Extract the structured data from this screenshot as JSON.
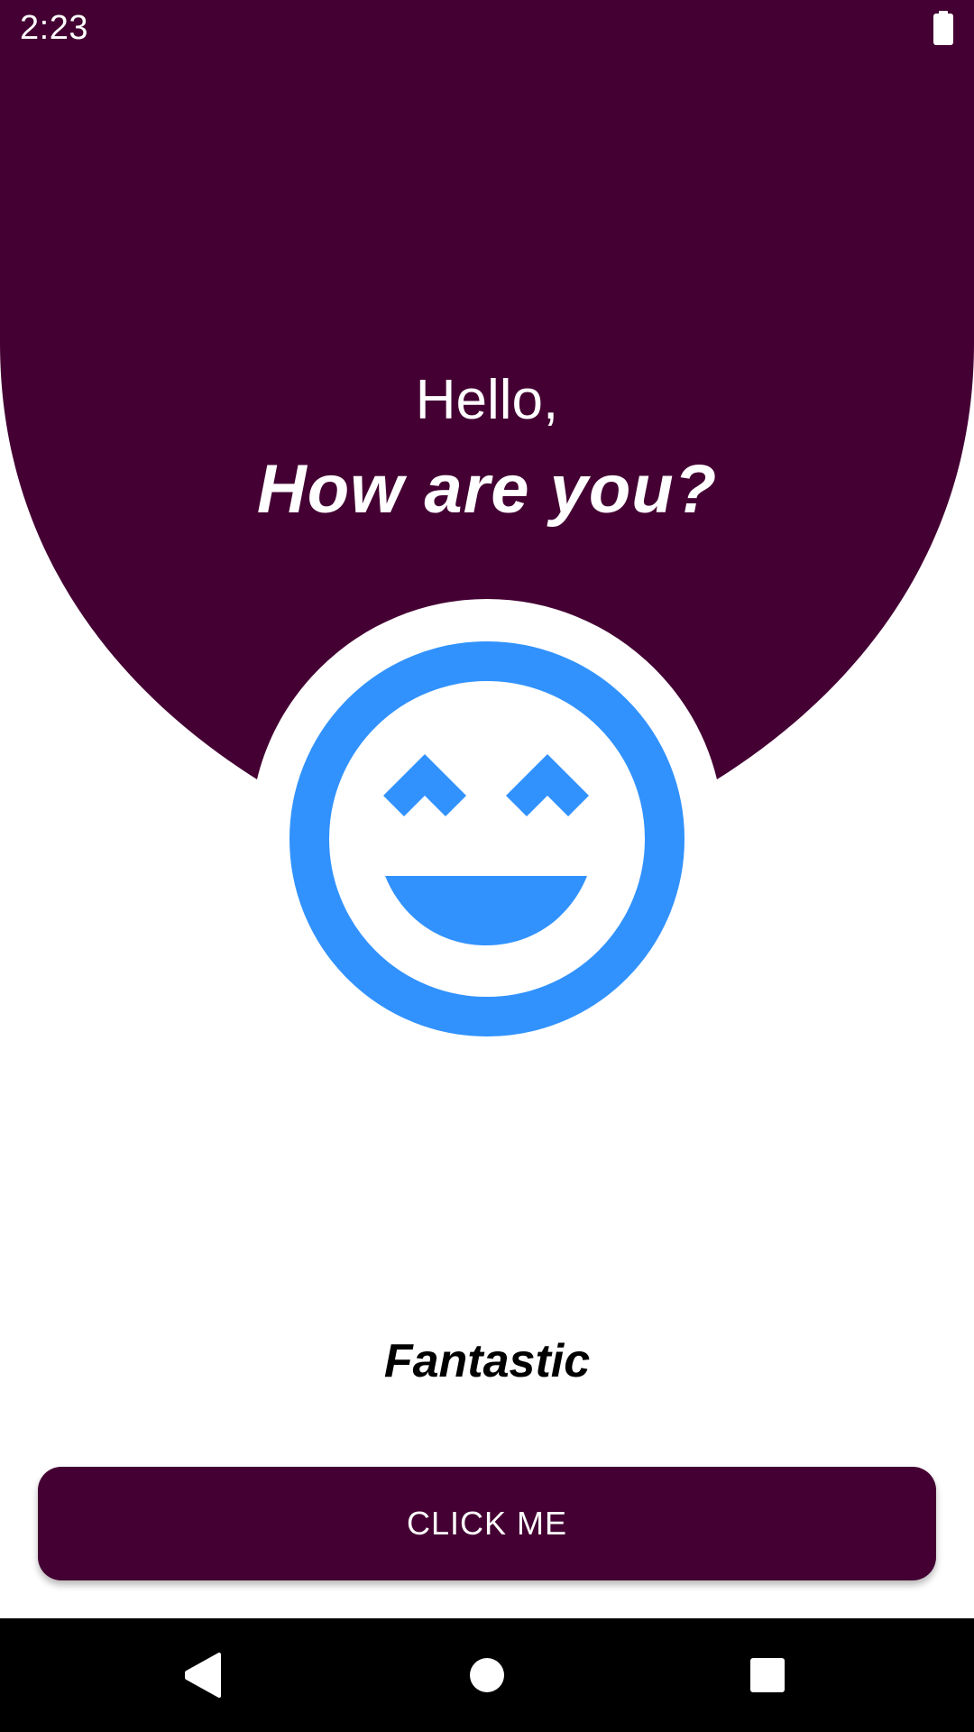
{
  "colors": {
    "primary": "#440033",
    "accent_blue": "#3192FE",
    "background": "#FFFFFF",
    "text_dark": "#000000",
    "text_light": "#FFFFFF",
    "nav_bar": "#000000"
  },
  "status_bar": {
    "time": "2:23",
    "battery_icon": "battery-full-icon"
  },
  "greeting": {
    "hello": "Hello,",
    "question": "How are you?"
  },
  "emoji": {
    "icon": "laughing-face-icon"
  },
  "mood": {
    "label": "Fantastic"
  },
  "button": {
    "label": "CLICK ME"
  },
  "nav_bar": {
    "back_icon": "back-triangle-icon",
    "home_icon": "home-circle-icon",
    "recents_icon": "recents-square-icon"
  }
}
